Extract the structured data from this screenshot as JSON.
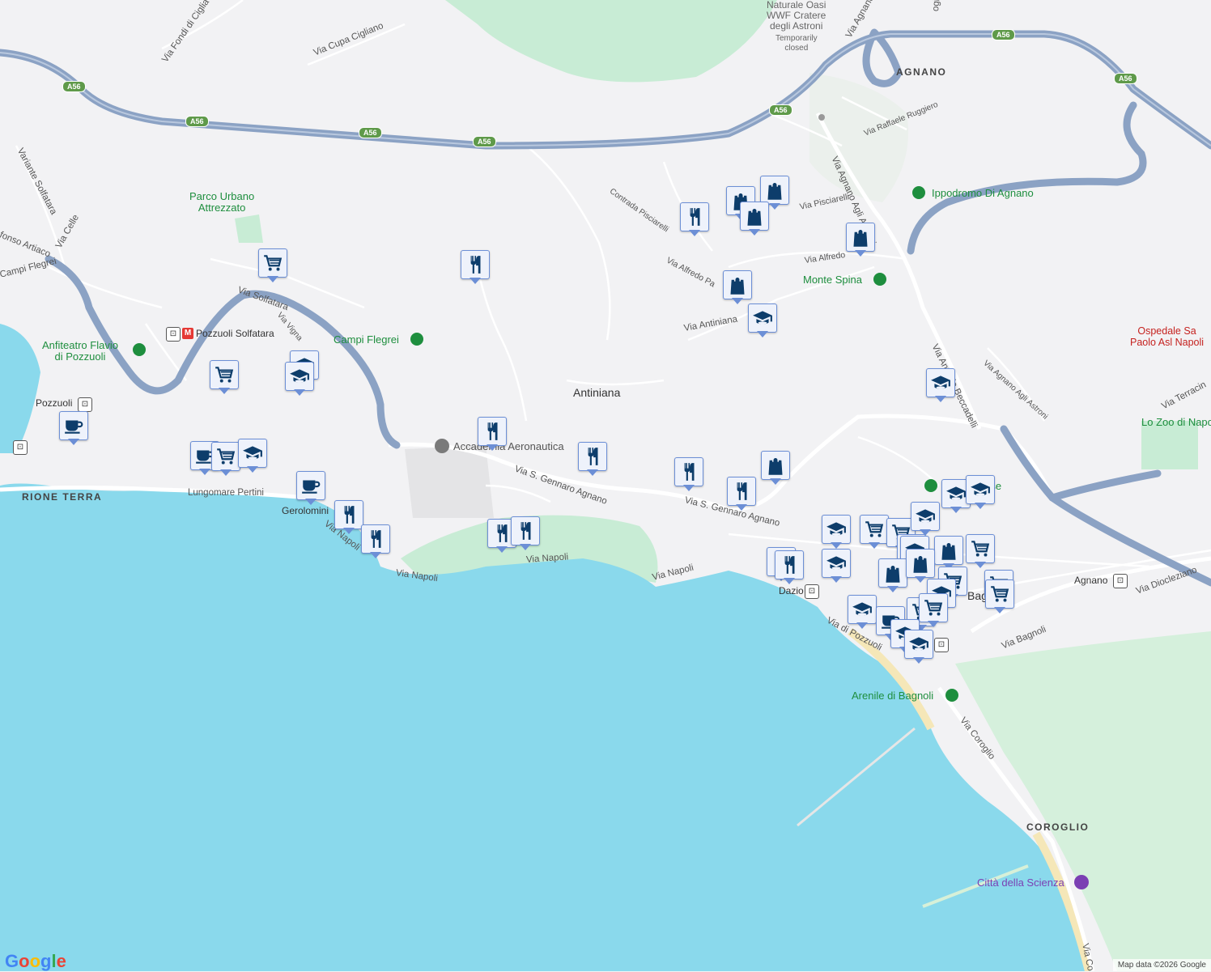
{
  "map": {
    "water_color": "#8ad9ec",
    "land_color": "#f2f2f4",
    "park_color": "#c8ecd5",
    "highway_color": "#8ba2c4",
    "pin_color": "#0d3d6b"
  },
  "place_labels": {
    "antiniana": "Antiniana",
    "agnano": "AGNANO",
    "rione_terra": "RIONE TERRA",
    "coroglio": "COROGLIO",
    "pozzuoli": "Pozzuoli",
    "gerolomini": "Gerolomini",
    "dazio": "Dazio",
    "agnano_station": "Agnano",
    "bagnoli": "Bag",
    "laise": "Laise"
  },
  "poi_labels": {
    "parco_urbano": "Parco Urbano\nAttrezzato",
    "campi_flegrei": "Campi Flegrei",
    "accademia": "Accademia Aeronautica",
    "anfiteatro": "Anfiteatro Flavio\ndi Pozzuoli",
    "pozzuoli_solfatara": "Pozzuoli Solfatara",
    "ippodromo": "Ippodromo Di Agnano",
    "monte_spina": "Monte Spina",
    "ospedale": "Ospedale Sa\nPaolo Asl Napoli",
    "zoo": "Lo Zoo di Napo",
    "arenile": "Arenile di Bagnoli",
    "citta_scienza": "Città della Scienza",
    "oasi": "Naturale Oasi\nWWF Cratere\ndegli Astroni",
    "oasi_status": "Temporarily\nclosed"
  },
  "road_labels": {
    "via_cupa_cigliano": "Via Cupa Cigliano",
    "via_fondi": "Via Fondi di Ciglia",
    "variante_solfatara": "Variante Solfatara",
    "via_celle": "Via Celle",
    "alfonso_artiaco": "fonso Artiaco",
    "campi_flegrei_road": "Campi Flegrei",
    "via_solfatara": "Via Solfatara",
    "via_vigna": "Via Vigna",
    "lungomare": "Lungomare Pertini",
    "via_napoli_1": "Via Napoli",
    "via_napoli_2": "Via Napoli",
    "via_napoli_3": "Via Napoli",
    "via_napoli_4": "Via Napoli",
    "via_s_gennaro_1": "Via S. Gennaro Agnano",
    "via_s_gennaro_2": "Via S. Gennaro Agnano",
    "via_antiniana": "Via Antiniana",
    "contrada_pisciarelli": "Contrada Pisciarelli",
    "via_alfredo_pa": "Via Alfredo Pa",
    "via_alfredo": "Via Alfredo",
    "via_pisciarelli": "Via Pisciarelli",
    "via_raffaele": "Via Raffaele Ruggiero",
    "via_agnano_astroni": "Via Agnano Agli Astroni",
    "via_agnano_astroni_2": "Via Agnano Agli Astroni",
    "via_beccadelli": "Via Antonio Beccadelli",
    "via_di_pozzuoli": "Via di Pozzuoli",
    "via_bagnoli": "Via Bagnoli",
    "via_diocleziano": "Via Diocleziano",
    "via_coroglio": "Via Coroglio",
    "via_coroglio_2": "Via Co",
    "via_terracina": "Via Terracin",
    "via_agnano_top": "Via Agnano",
    "via_ogia": "ogia"
  },
  "highway_shields": [
    "A56",
    "A56",
    "A56",
    "A56",
    "A56",
    "A56"
  ],
  "attribution": "Map data ©2026 Google",
  "logo": "Google"
}
